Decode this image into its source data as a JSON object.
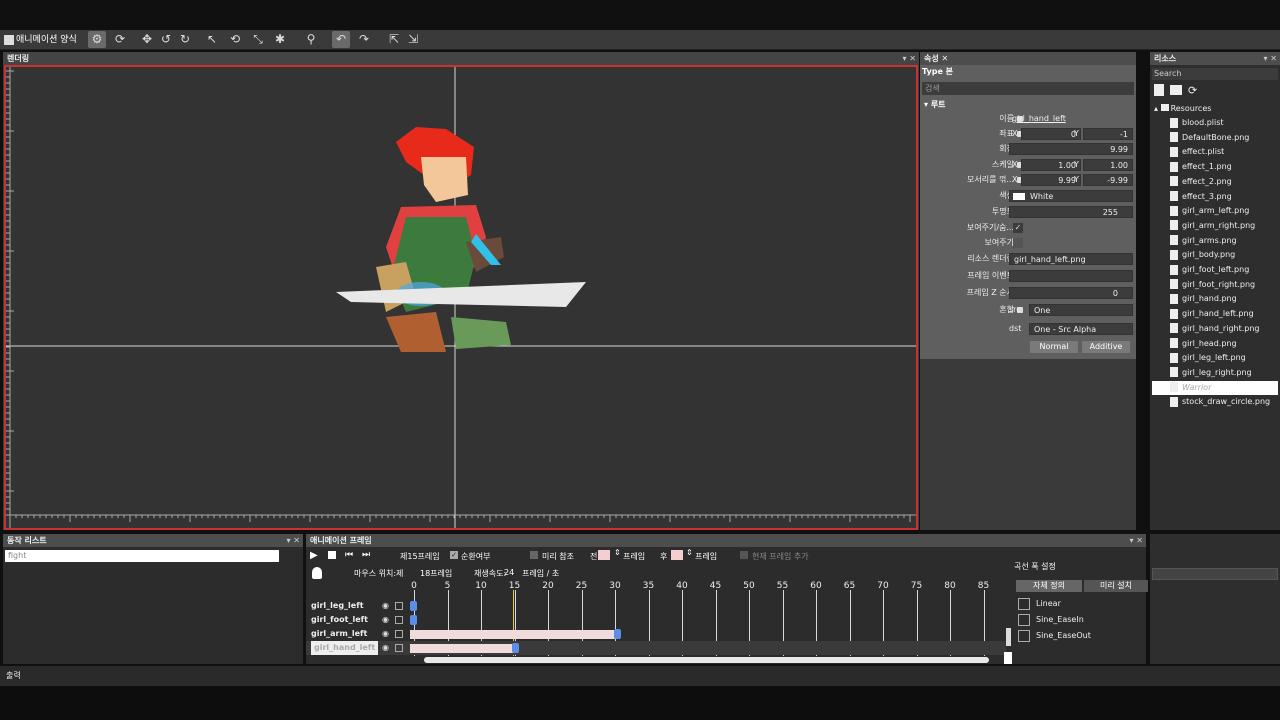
{
  "toolbar": {
    "mode_label": "애니메이션 양식",
    "icons": [
      "animation-icon",
      "refresh-icon",
      "move-icon",
      "rotate-left-icon",
      "rotate-right-icon",
      "select-icon",
      "rotate-icon",
      "scale-icon",
      "bone-icon",
      "link-icon",
      "flip-icon",
      "next-icon",
      "export-icon",
      "import-icon"
    ]
  },
  "viewport": {
    "title": "렌더링"
  },
  "properties": {
    "tab": "속성",
    "type_label": "Type 본",
    "search_placeholder": "검색",
    "section": "루트",
    "name_label": "이름",
    "name_value": "girl_hand_left",
    "pos_label": "좌표",
    "pos_x": "0",
    "pos_y": "-1",
    "rot_label": "회전",
    "rot_value": "9.99",
    "scale_label": "스케일",
    "scale_x": "1.00",
    "scale_y": "1.00",
    "skew_label": "모서리를 꺾...",
    "skew_x": "9.99",
    "skew_y": "-9.99",
    "color_label": "색상",
    "color_value": "White",
    "opacity_label": "투명도",
    "opacity_value": "255",
    "visible_hint_label": "보여주기/숨...",
    "visible_label": "보여주기",
    "resource_label": "리소스 렌더링",
    "resource_value": "girl_hand_left.png",
    "frame_event_label": "프레임 이벤트",
    "frame_z_label": "프레임 Z 순서",
    "frame_z_value": "0",
    "blend_label": "혼합",
    "src_label": "src",
    "src_value": "One",
    "dst_label": "dst",
    "dst_value": "One - Src Alpha",
    "normal_btn": "Normal",
    "additive_btn": "Additive",
    "x": "X",
    "y": "Y"
  },
  "resources": {
    "tab": "리소스",
    "search_placeholder": "Search",
    "root": "Resources",
    "items": [
      "blood.plist",
      "DefaultBone.png",
      "effect.plist",
      "effect_1.png",
      "effect_2.png",
      "effect_3.png",
      "girl_arm_left.png",
      "girl_arm_right.png",
      "girl_arms.png",
      "girl_body.png",
      "girl_foot_left.png",
      "girl_foot_right.png",
      "girl_hand.png",
      "girl_hand_left.png",
      "girl_hand_right.png",
      "girl_head.png",
      "girl_leg_left.png",
      "girl_leg_right.png",
      "Warrior",
      "stock_draw_circle.png"
    ]
  },
  "actionlist": {
    "title": "동작 리스트",
    "item": "fight"
  },
  "timeline": {
    "title": "애니메이션 프레임",
    "frame_label": "제15프레임",
    "loop_label": "순환여부",
    "onion_label": "미리 참조",
    "prev_label": "전",
    "frames_label": "프레임",
    "next_label": "후",
    "frames_label2": "프레임",
    "current_frame_add": "현재 프레임 추가",
    "mouse_pos_label": "마우스 위치:제",
    "mouse_frame": "18프레임",
    "speed_label": "재생속도:",
    "speed_value": "24",
    "speed_unit": "프레임 / 초",
    "ticks": [
      "0",
      "5",
      "10",
      "15",
      "20",
      "25",
      "30",
      "35",
      "40",
      "45",
      "50",
      "55",
      "60",
      "65",
      "70",
      "75",
      "80",
      "85"
    ],
    "tracks": [
      "girl_leg_left",
      "girl_foot_left",
      "girl_arm_left",
      "girl_hand_left"
    ]
  },
  "curves": {
    "title": "곡선 폭 설정",
    "tab1": "자체 정의",
    "tab2": "미리 설치",
    "items": [
      "Linear",
      "Sine_EaseIn",
      "Sine_EaseOut"
    ]
  },
  "output": {
    "title": "출력"
  },
  "colors": {
    "accent": "#c83232",
    "key": "#5b8ee6",
    "bar": "#f0dcdc"
  }
}
